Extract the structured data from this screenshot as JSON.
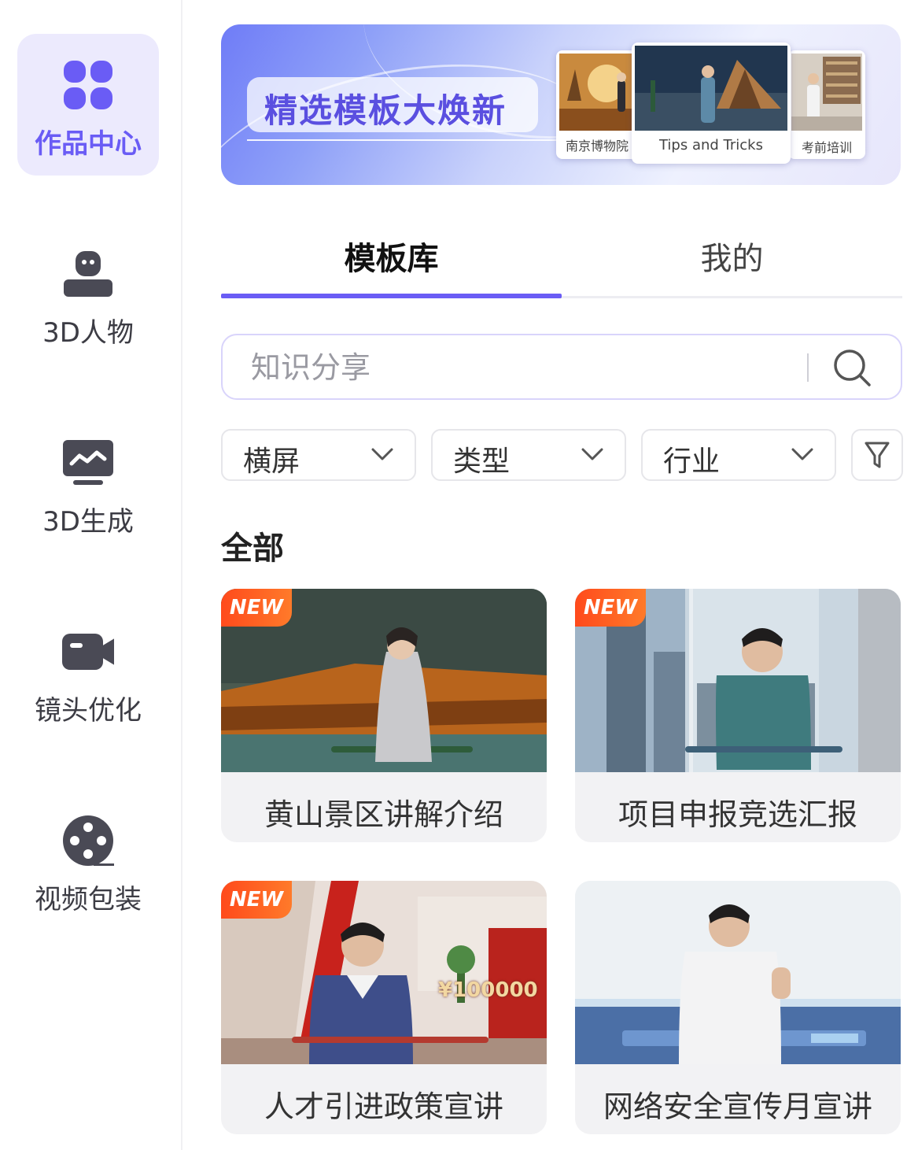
{
  "sidebar": {
    "items": [
      {
        "label": "作品中心",
        "icon": "grid-icon",
        "active": true
      },
      {
        "label": "3D人物",
        "icon": "robot-icon"
      },
      {
        "label": "3D生成",
        "icon": "monitor-chart-icon"
      },
      {
        "label": "镜头优化",
        "icon": "video-camera-icon"
      },
      {
        "label": "视频包装",
        "icon": "film-reel-icon"
      }
    ]
  },
  "banner": {
    "title": "精选模板大焕新",
    "thumbs": [
      {
        "caption": "南京博物院"
      },
      {
        "caption": "Tips and Tricks"
      },
      {
        "caption": "考前培训"
      }
    ]
  },
  "tabs": [
    {
      "label": "模板库",
      "active": true
    },
    {
      "label": "我的"
    }
  ],
  "search": {
    "placeholder": "知识分享"
  },
  "filters": [
    {
      "label": "横屏"
    },
    {
      "label": "类型"
    },
    {
      "label": "行业"
    }
  ],
  "section": {
    "title": "全部"
  },
  "cards": [
    {
      "title": "黄山景区讲解介绍",
      "badge": "NEW"
    },
    {
      "title": "项目申报竞选汇报",
      "badge": "NEW"
    },
    {
      "title": "人才引进政策宣讲",
      "badge": "NEW",
      "overlay": "¥100000"
    },
    {
      "title": "网络安全宣传月宣讲"
    }
  ],
  "colors": {
    "accent": "#6a5cf5",
    "active_bg": "#eceafd",
    "badge": "#ff5a22"
  }
}
